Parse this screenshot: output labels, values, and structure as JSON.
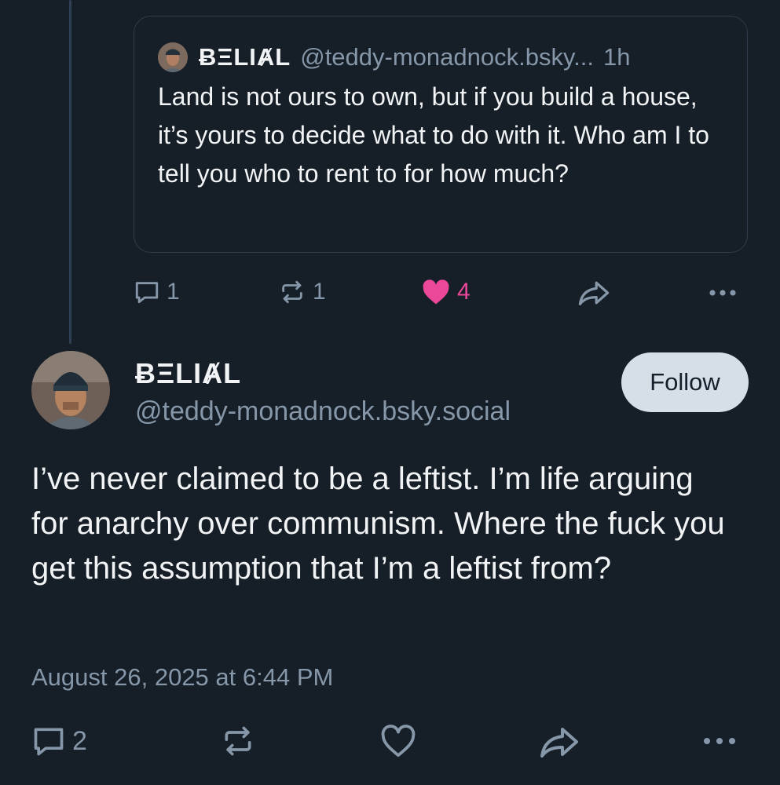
{
  "quoted_reply": {
    "author_name": "ɃΞLIȺL",
    "author_handle": "@teddy-monadnock.bsky...",
    "time": "1h",
    "text": "Land is not ours to own, but if you build a house, it’s yours to decide what to do with it. Who am I to tell you who to rent to for how much?",
    "actions": {
      "replies": "1",
      "reposts": "1",
      "likes": "4",
      "liked": true
    }
  },
  "post": {
    "author_name": "ɃΞLIȺL",
    "author_handle": "@teddy-monadnock.bsky.social",
    "follow_label": "Follow",
    "text": "I’ve never claimed to be a leftist. I’m life arguing for anarchy over communism. Where the fuck you get this assumption that I’m a leftist from?",
    "date": "August 26, 2025 at 6:44 PM",
    "actions": {
      "replies": "2"
    }
  },
  "icons": {
    "reply": "speech-bubble-icon",
    "repost": "repost-arrows-icon",
    "like": "heart-icon",
    "share": "share-arrow-icon",
    "more": "more-dots-icon"
  },
  "colors": {
    "background": "#161e27",
    "muted_text": "#8597a8",
    "like_active": "#ec4899",
    "follow_button": "#d6dee8"
  }
}
